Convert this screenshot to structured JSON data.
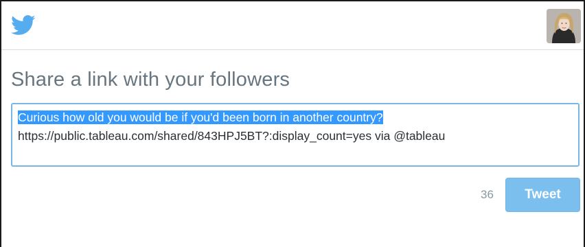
{
  "header": {
    "logo_icon": "twitter-bird-icon",
    "brand_color": "#55acee",
    "avatar": "user-avatar"
  },
  "main": {
    "title": "Share a link with your followers",
    "tweet_text": {
      "selected_line": "Curious how old you would be if you'd been born in another country?",
      "link_line": "https://public.tableau.com/shared/843HPJ5BT?:display_count=yes via @tableau"
    },
    "char_count": "36",
    "tweet_button_label": "Tweet",
    "colors": {
      "title": "#66757f",
      "textarea_border": "#79b6e3",
      "selection": "#3399ff",
      "tweet_button": "#7bbfef",
      "counter": "#8899a6"
    }
  }
}
